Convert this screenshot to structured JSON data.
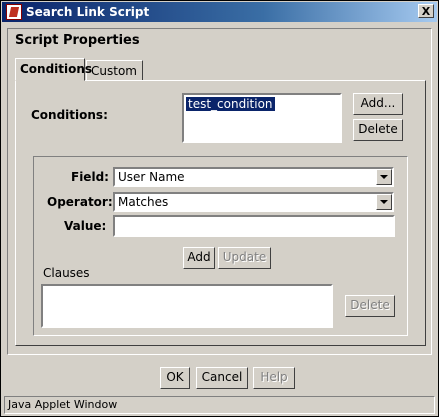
{
  "window": {
    "title": "Search Link Script",
    "close_glyph": "X"
  },
  "panel": {
    "heading": "Script Properties"
  },
  "tabs": [
    {
      "label": "Conditions",
      "selected": true
    },
    {
      "label": "Custom",
      "selected": false
    }
  ],
  "conditions": {
    "label": "Conditions:",
    "items": [
      "test_condition"
    ],
    "add_label": "Add...",
    "delete_label": "Delete"
  },
  "clause_editor": {
    "field_label": "Field:",
    "field_value": "User Name",
    "operator_label": "Operator:",
    "operator_value": "Matches",
    "value_label": "Value:",
    "value_text": "",
    "add_label": "Add",
    "update_label": "Update",
    "clauses_label": "Clauses",
    "clauses_delete_label": "Delete"
  },
  "footer": {
    "ok_label": "OK",
    "cancel_label": "Cancel",
    "help_label": "Help"
  },
  "statusbar": {
    "text": "Java Applet Window"
  },
  "icons": {
    "title": "java-applet-icon",
    "close": "close-icon",
    "dropdown": "chevron-down-icon"
  }
}
